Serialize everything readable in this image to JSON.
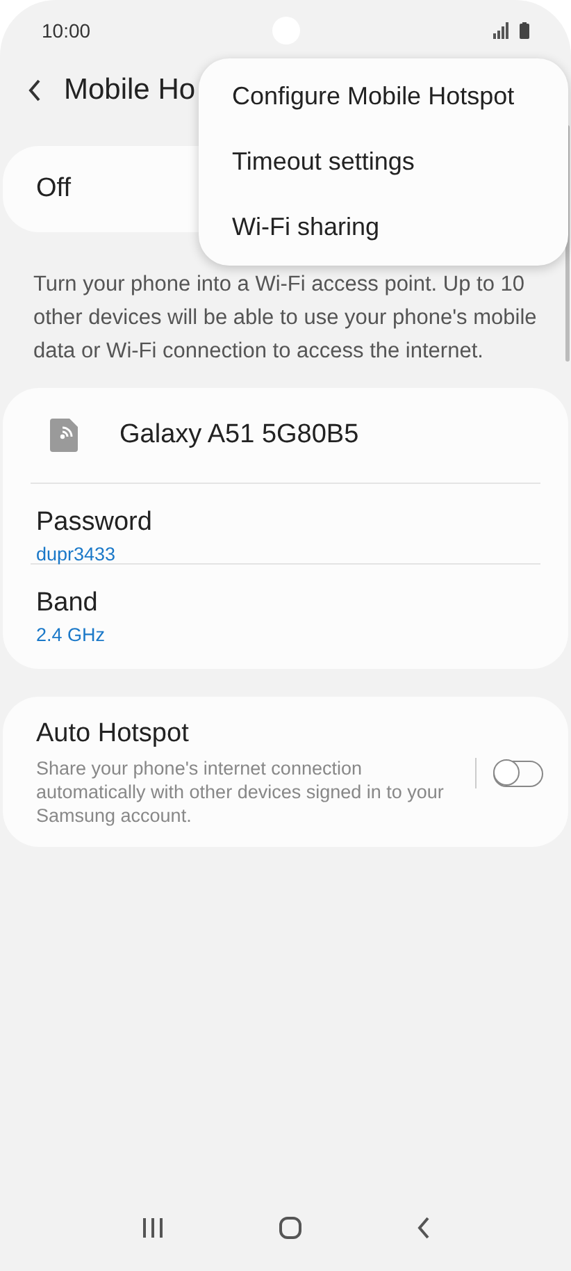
{
  "status_bar": {
    "time": "10:00"
  },
  "header": {
    "title": "Mobile Ho"
  },
  "master": {
    "label": "Off"
  },
  "menu": {
    "items": [
      "Configure Mobile Hotspot",
      "Timeout settings",
      "Wi-Fi sharing"
    ]
  },
  "description": "Turn your phone into a Wi-Fi access point. Up to 10 other devices will be able to use your phone's mobile data or Wi-Fi connection to access the internet.",
  "network": {
    "name": "Galaxy A51 5G80B5",
    "rows": [
      {
        "label": "Password",
        "value": "dupr3433"
      },
      {
        "label": "Band",
        "value": "2.4 GHz"
      }
    ]
  },
  "auto_hotspot": {
    "title": "Auto Hotspot",
    "summary": "Share your phone's internet connection automatically with other devices signed in to your Samsung account.",
    "on": false
  }
}
